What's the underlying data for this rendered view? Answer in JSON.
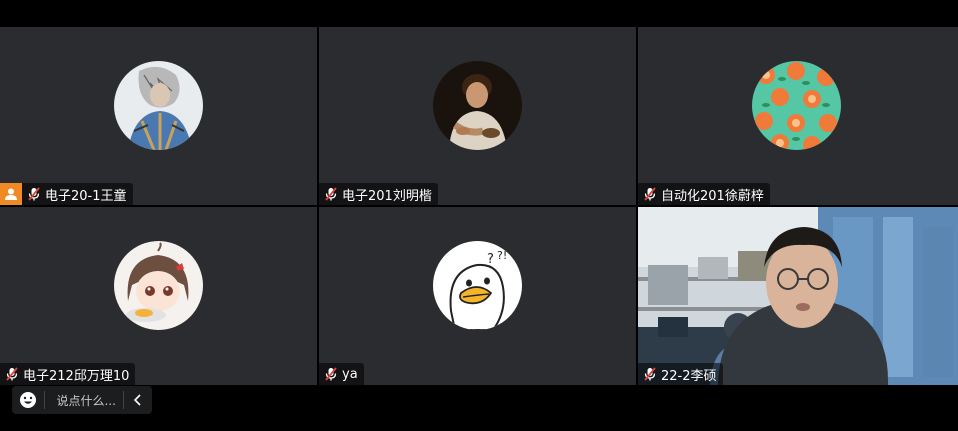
{
  "participants": [
    {
      "name": "电子20-1王童",
      "is_host": true,
      "muted": true,
      "avatar": "photo-person-sketch"
    },
    {
      "name": "电子201刘明楷",
      "is_host": false,
      "muted": true,
      "avatar": "painting-boy"
    },
    {
      "name": "自动化201徐蔚梓",
      "is_host": false,
      "muted": true,
      "avatar": "oranges-pattern"
    },
    {
      "name": "电子212邱万理10",
      "is_host": false,
      "muted": true,
      "avatar": "anime-girl"
    },
    {
      "name": "ya",
      "is_host": false,
      "muted": true,
      "avatar": "cartoon-duck"
    },
    {
      "name": "22-2李硕",
      "is_host": false,
      "muted": true,
      "avatar": "webcam-video"
    }
  ],
  "chat": {
    "placeholder": "说点什么..."
  },
  "colors": {
    "tile_bg": "#2a2c2f",
    "host_badge": "#f08a24",
    "mute_red": "#e0463f"
  }
}
